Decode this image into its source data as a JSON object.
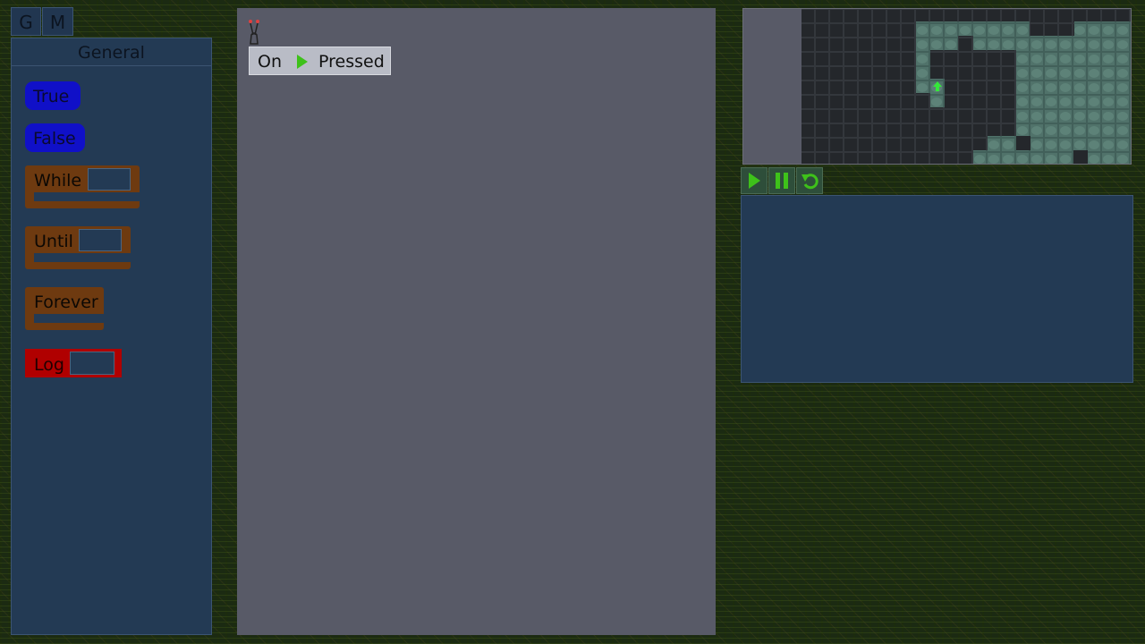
{
  "tabs": {
    "general": "G",
    "movement": "M"
  },
  "palette": {
    "title": "General",
    "true_label": "True",
    "false_label": "False",
    "while_label": "While",
    "until_label": "Until",
    "forever_label": "Forever",
    "log_label": "Log"
  },
  "workspace": {
    "event_on": "On",
    "event_pressed": "Pressed"
  },
  "controls": {
    "play_icon": "play-icon",
    "pause_icon": "pause-icon",
    "reset_icon": "reset-icon"
  },
  "colors": {
    "bool_block": "#1010c8",
    "loop_block": "#6e3a10",
    "log_block": "#b00000",
    "accent_green": "#3ec11a",
    "panel_bg": "#233a54",
    "workspace_bg": "#585a67"
  },
  "console": {
    "text": ""
  }
}
